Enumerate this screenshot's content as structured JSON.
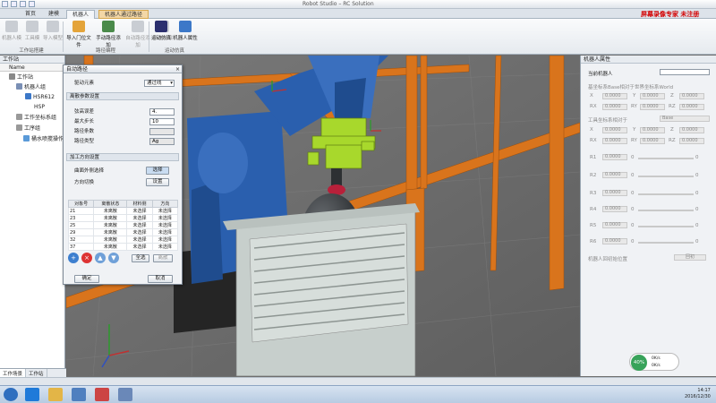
{
  "app": {
    "title": "Robot Studio – RC Solution",
    "window_title": "Robot Studio – RC Solution",
    "promo": "屏幕录像专家  未注册"
  },
  "ribbon": {
    "tabs": [
      "首页",
      "建模",
      "机器人"
    ],
    "active_tab": "机器人",
    "header_tab_extra": "机器人通过路径",
    "buttons": [
      {
        "label": "机器人模",
        "enabled": false
      },
      {
        "label": "工具模",
        "enabled": false
      },
      {
        "label": "导入模型",
        "enabled": false
      },
      {
        "label": "导入门位文件",
        "enabled": true
      },
      {
        "label": "手动路径添加",
        "enabled": true
      },
      {
        "label": "自动路径添加",
        "enabled": false
      },
      {
        "label": "轨迹补偿",
        "enabled": false
      },
      {
        "label": "运动仿真",
        "enabled": true
      },
      {
        "label": "机器人属性",
        "enabled": true
      }
    ],
    "groups": [
      "工作站搭建",
      "路径编程",
      "运动仿真"
    ]
  },
  "left_panel": {
    "title": "工作站",
    "column": "Name",
    "tree": [
      {
        "label": "工作站",
        "level": 0
      },
      {
        "label": "机器人组",
        "level": 1
      },
      {
        "label": "HSR612",
        "level": 2
      },
      {
        "label": "HSP",
        "level": 3
      },
      {
        "label": "工作坐标系组",
        "level": 1
      },
      {
        "label": "工序组",
        "level": 1
      },
      {
        "label": "桶水喷搅操作",
        "level": 2
      }
    ],
    "bottom_tabs": [
      "工作场景",
      "工作站"
    ]
  },
  "dialog": {
    "title": "自动路径",
    "close": "×",
    "drive_label": "驱动元素",
    "drive_value": "通过线",
    "section1": "离散参数设置",
    "fields": [
      {
        "label": "弦高误差",
        "value": "4."
      },
      {
        "label": "最大步长",
        "value": "10"
      },
      {
        "label": "路径条数",
        "value": ""
      },
      {
        "label": "路径类型",
        "value": "Ag"
      }
    ],
    "section2": "加工方向设置",
    "dir_rows": [
      {
        "label": "曲面外侧选择",
        "button": "选择"
      },
      {
        "label": "方向切换",
        "button": "设置"
      }
    ],
    "table_headers": [
      "对象号",
      "离散状态",
      "材料侧",
      "方向"
    ],
    "table_rows": [
      [
        "21",
        "未离散",
        "未选择",
        "未选择"
      ],
      [
        "23",
        "未离散",
        "未选择",
        "未选择"
      ],
      [
        "25",
        "未离散",
        "未选择",
        "未选择"
      ],
      [
        "29",
        "未离散",
        "未选择",
        "未选择"
      ],
      [
        "32",
        "未离散",
        "未选择",
        "未选择"
      ],
      [
        "37",
        "未离散",
        "未选择",
        "未选择"
      ]
    ],
    "tool_buttons": [
      "add",
      "delete",
      "up",
      "down"
    ],
    "select_all": "全选",
    "discretize": "离散",
    "ok": "确定",
    "cancel": "取消"
  },
  "right_panel": {
    "title": "机器人属性",
    "current_robot_label": "当前机器人",
    "base_frame_label": "基坐标系Base相对于世界坐标系World",
    "tool_frame_label": "工具坐标系相对于",
    "tool_frame_value": "Base",
    "coord_labels": [
      "X",
      "Y",
      "Z",
      "RX",
      "RY",
      "RZ"
    ],
    "coord_value": "0.0000",
    "joints": [
      {
        "label": "R1",
        "value": "0.0000",
        "num": "0"
      },
      {
        "label": "R2",
        "value": "0.0000",
        "num": "0"
      },
      {
        "label": "R3",
        "value": "0.0000",
        "num": "0"
      },
      {
        "label": "R4",
        "value": "0.0000",
        "num": "0"
      },
      {
        "label": "R5",
        "value": "0.0000",
        "num": "0"
      },
      {
        "label": "R6",
        "value": "0.0000",
        "num": "0"
      }
    ],
    "home_label": "机器人回初始位置",
    "home_button": "回初"
  },
  "gauge": {
    "percent": "40%",
    "up": "0K/s",
    "down": "0K/s"
  },
  "clock": {
    "time": "14:17",
    "date": "2016/12/30"
  },
  "colors": {
    "robot": "#2a5fae",
    "gripper": "#a8d82c",
    "frame": "#d9741c",
    "bottle": "#3a3d40"
  }
}
